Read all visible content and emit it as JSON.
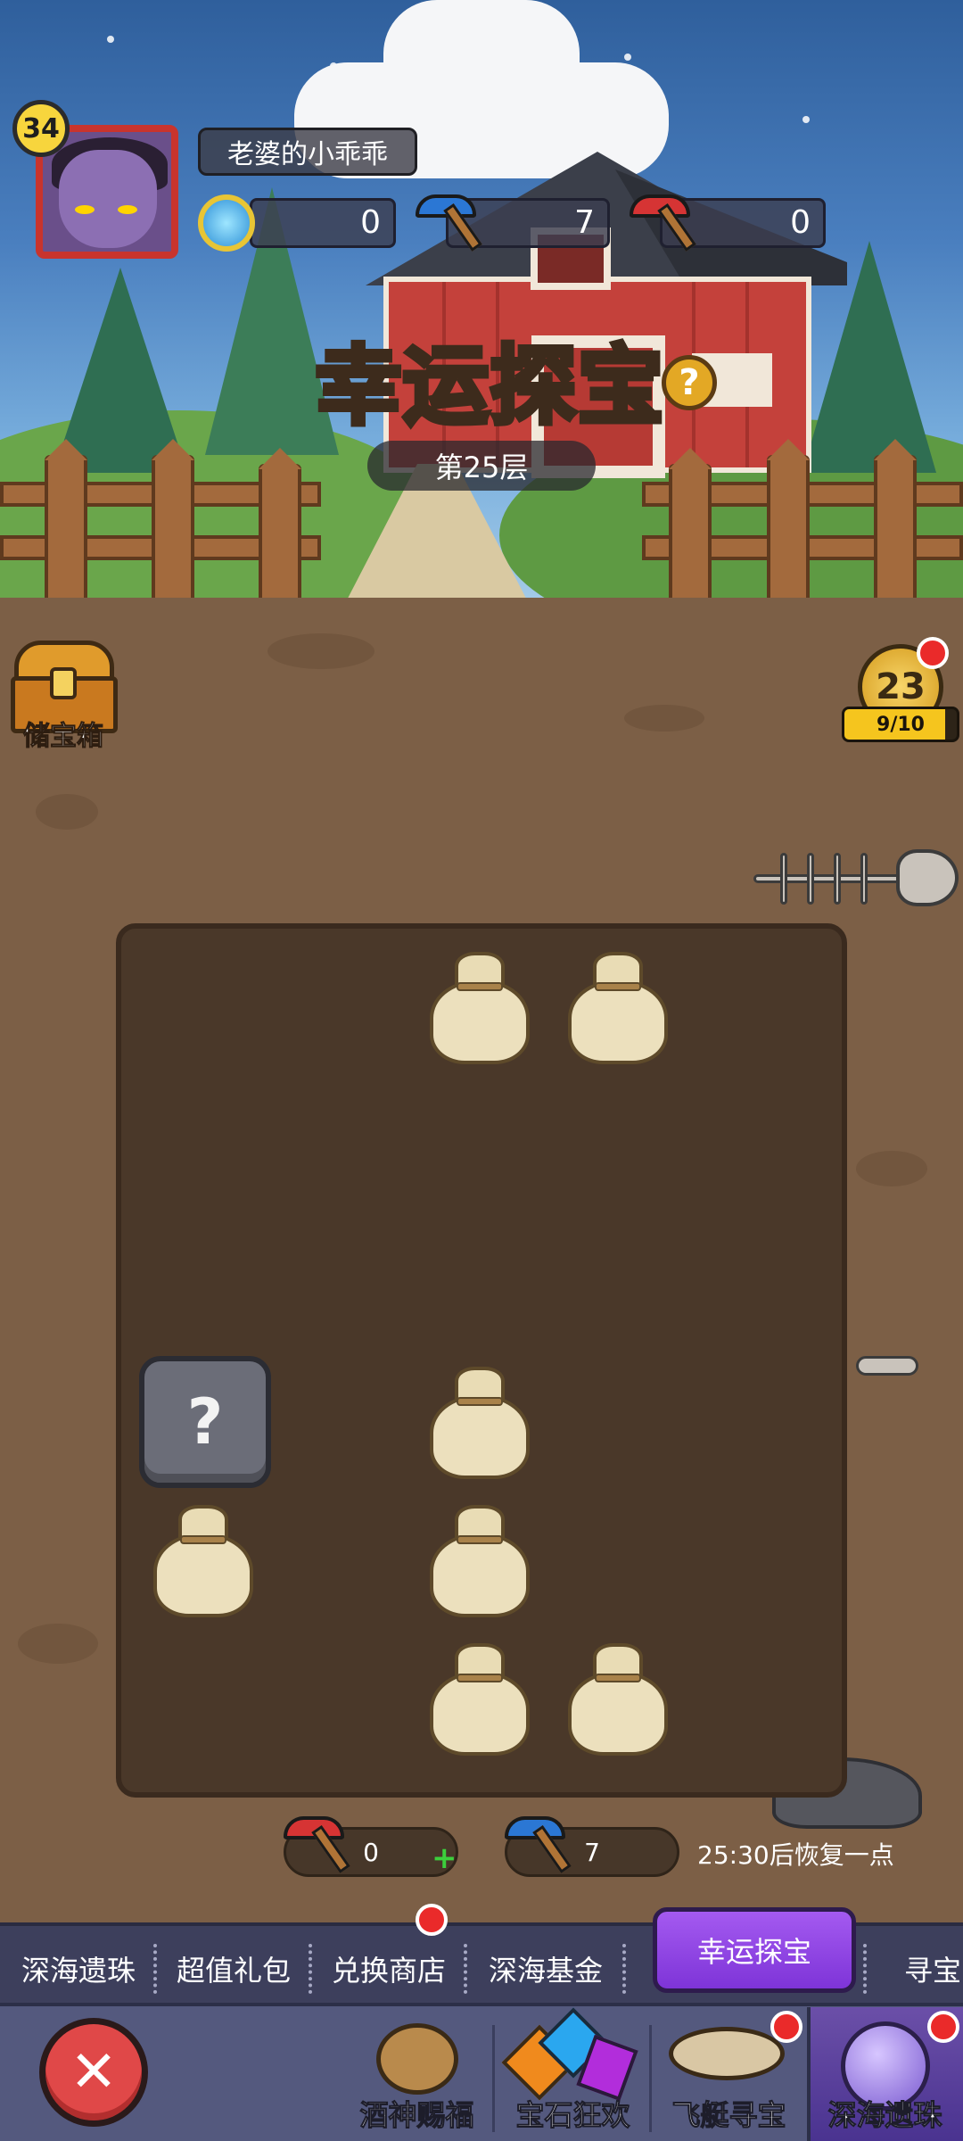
{
  "player": {
    "name": "老婆的小乖乖",
    "level": "34"
  },
  "resources": {
    "gems": "0",
    "blue_pickaxe": "7",
    "red_pickaxe": "0"
  },
  "game": {
    "title": "幸运探宝",
    "floor": "第25层",
    "chest_label": "储宝箱",
    "coin_count": "23",
    "progress_text": "9/10",
    "progress_fraction": 0.9
  },
  "grid": {
    "rows": 6,
    "cols": 5,
    "cells": [
      {
        "row": 0,
        "col": 2,
        "type": "bag"
      },
      {
        "row": 0,
        "col": 3,
        "type": "bag"
      },
      {
        "row": 3,
        "col": 0,
        "type": "mystery"
      },
      {
        "row": 3,
        "col": 2,
        "type": "bag"
      },
      {
        "row": 4,
        "col": 0,
        "type": "bag"
      },
      {
        "row": 4,
        "col": 2,
        "type": "bag"
      },
      {
        "row": 5,
        "col": 2,
        "type": "bag"
      },
      {
        "row": 5,
        "col": 3,
        "type": "bag"
      }
    ],
    "mystery_glyph": "?"
  },
  "counters": {
    "red_pickaxe": "0",
    "blue_pickaxe": "7",
    "regen_text": "25:30后恢复一点",
    "plus_glyph": "+"
  },
  "tabs": [
    {
      "label": "深海遗珠"
    },
    {
      "label": "超值礼包"
    },
    {
      "label": "兑换商店"
    },
    {
      "label": "深海基金"
    },
    {
      "label": "幸运探宝"
    },
    {
      "label": "寻宝"
    }
  ],
  "dock": {
    "close_glyph": "✕",
    "items": [
      {
        "label": "酒神赐福"
      },
      {
        "label": "宝石狂欢"
      },
      {
        "label": "飞艇寻宝"
      },
      {
        "label": "深海遗珠"
      }
    ]
  },
  "colors": {
    "active_tab": "#8b3fe4",
    "close_button": "#e04848",
    "notification": "#ea2a2a"
  },
  "icons": {
    "gem": "gem-icon",
    "blue_pickaxe": "blue-pickaxe-icon",
    "red_pickaxe": "red-pickaxe-icon",
    "help": "help-icon",
    "chest": "treasure-chest-icon",
    "coin": "coin-icon",
    "bag": "treasure-bag-icon",
    "close": "close-icon"
  }
}
